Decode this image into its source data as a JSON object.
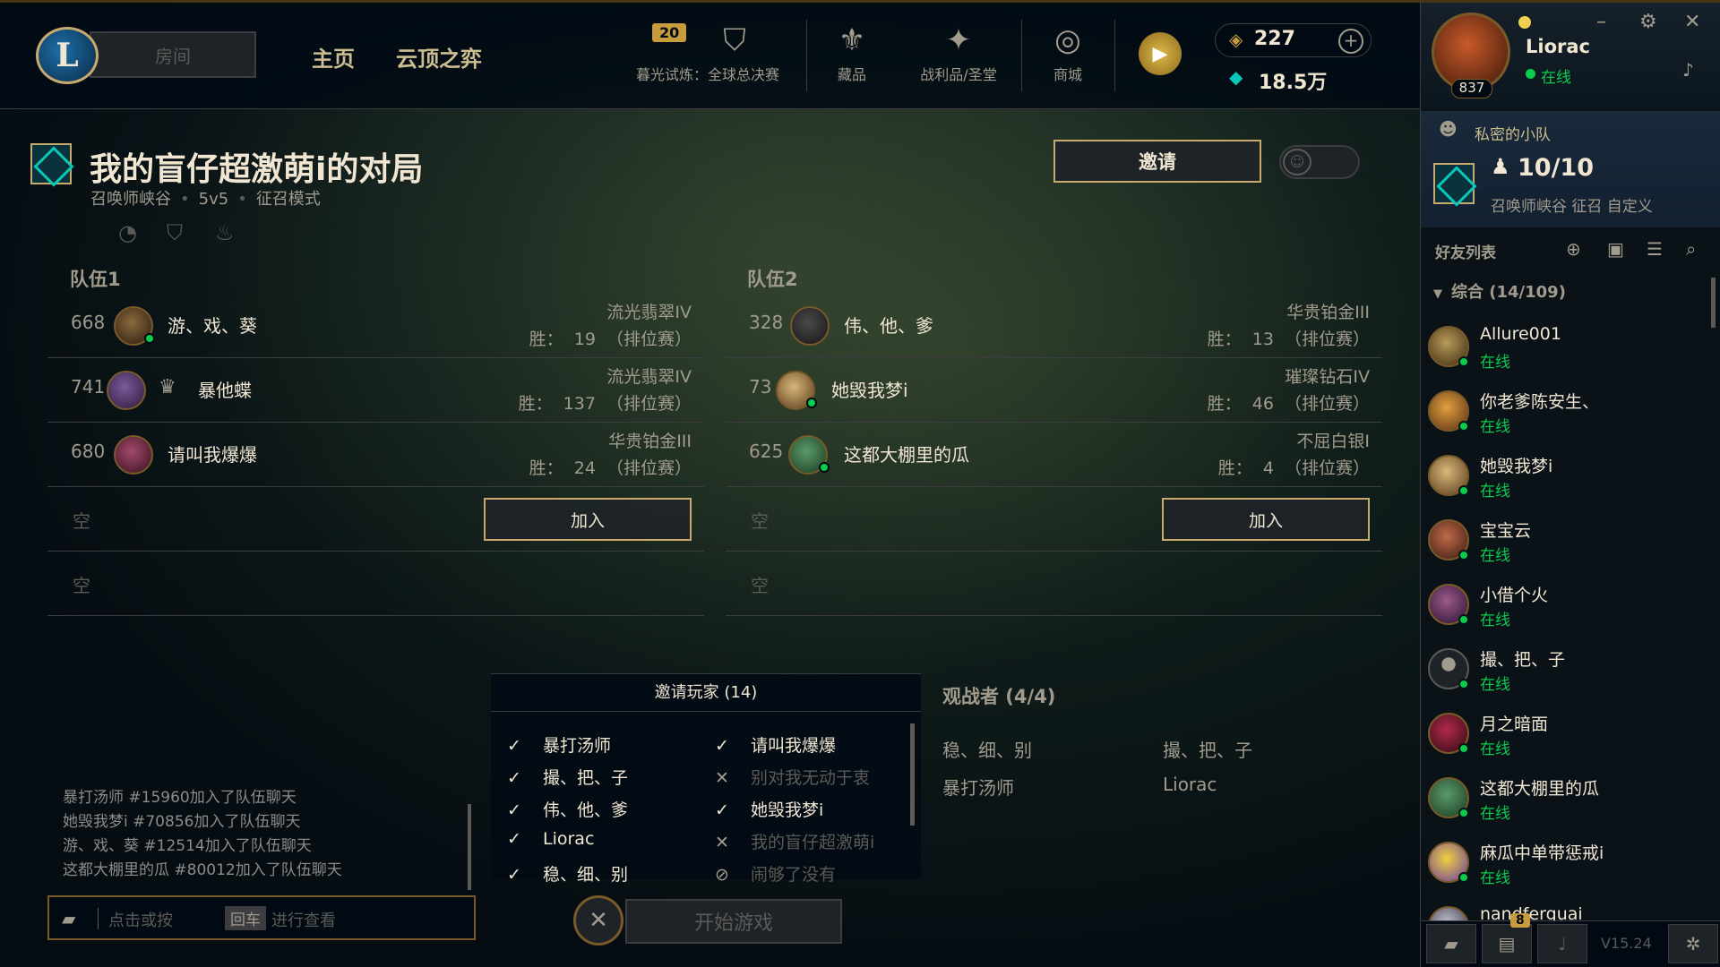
{
  "nav": {
    "room_label": "房间",
    "home": "主页",
    "tft": "云顶之弈",
    "event_badge": "20",
    "event_label": "暮光试炼：全球总决赛",
    "collection": "藏品",
    "loot": "战利品/圣堂",
    "store": "商城",
    "rp": "227",
    "blue_essence": "18.5万"
  },
  "lobby": {
    "title": "我的盲仔超激萌i的对局",
    "map": "召唤师峡谷",
    "size": "5v5",
    "mode": "征召模式",
    "invite_button": "邀请"
  },
  "teams": [
    {
      "label": "队伍1",
      "players": [
        {
          "level": "668",
          "name": "游、戏、葵",
          "rank": "流光翡翠IV",
          "wins": "胜：  19  （排位赛）",
          "online": true
        },
        {
          "level": "741",
          "name": "暴他蝶",
          "rank": "流光翡翠IV",
          "wins": "胜：  137  （排位赛）",
          "online": false
        },
        {
          "level": "680",
          "name": "请叫我爆爆",
          "rank": "华贵铂金III",
          "wins": "胜：  24  （排位赛）",
          "online": false
        }
      ],
      "empty_label": "空",
      "join_label": "加入"
    },
    {
      "label": "队伍2",
      "players": [
        {
          "level": "328",
          "name": "伟、他、爹",
          "rank": "华贵铂金III",
          "wins": "胜：  13  （排位赛）",
          "online": false
        },
        {
          "level": "73",
          "name": "她毁我梦i",
          "rank": "璀璨钻石IV",
          "wins": "胜：  46  （排位赛）",
          "online": true
        },
        {
          "level": "625",
          "name": "这都大棚里的瓜",
          "rank": "不屈白银I",
          "wins": "胜：  4  （排位赛）",
          "online": true
        }
      ],
      "empty_label": "空",
      "join_label": "加入"
    }
  ],
  "chat": {
    "lines": [
      "暴打汤师 #15960加入了队伍聊天",
      "她毁我梦i #70856加入了队伍聊天",
      "游、戏、葵 #12514加入了队伍聊天",
      "这都大棚里的瓜 #80012加入了队伍聊天"
    ],
    "placeholder_a": "点击或按",
    "key": "回车",
    "placeholder_b": "进行查看"
  },
  "invited": {
    "title": "邀请玩家 (14)",
    "items": [
      {
        "name": "暴打汤师",
        "mark": "✓",
        "state": "accepted"
      },
      {
        "name": "请叫我爆爆",
        "mark": "✓",
        "state": "accepted"
      },
      {
        "name": "撮、把、子",
        "mark": "✓",
        "state": "accepted"
      },
      {
        "name": "别对我无动于衷",
        "mark": "✕",
        "state": "declined"
      },
      {
        "name": "伟、他、爹",
        "mark": "✓",
        "state": "accepted"
      },
      {
        "name": "她毁我梦i",
        "mark": "✓",
        "state": "accepted"
      },
      {
        "name": "Liorac",
        "mark": "✓",
        "state": "accepted"
      },
      {
        "name": "我的盲仔超激萌i",
        "mark": "✕",
        "state": "declined"
      },
      {
        "name": "稳、细、别",
        "mark": "✓",
        "state": "accepted"
      },
      {
        "name": "闹够了没有",
        "mark": "⊘",
        "state": "blocked"
      }
    ],
    "start_label": "开始游戏"
  },
  "spectators": {
    "title": "观战者 (4/4)",
    "names": [
      "稳、细、别",
      "撮、把、子",
      "暴打汤师",
      "Liorac"
    ]
  },
  "profile": {
    "name": "Liorac",
    "status": "在线",
    "level": "837"
  },
  "party": {
    "header": "私密的小队",
    "count": "10/10",
    "mode": "召唤师峡谷 征召 自定义"
  },
  "friends": {
    "header": "好友列表",
    "group": "综合 (14/109)",
    "list": [
      {
        "name": "Allure001",
        "status": "在线"
      },
      {
        "name": "你老爹陈安生、",
        "status": "在线"
      },
      {
        "name": "她毁我梦i",
        "status": "在线"
      },
      {
        "name": "宝宝云",
        "status": "在线"
      },
      {
        "name": "小借个火",
        "status": "在线"
      },
      {
        "name": "撮、把、子",
        "status": "在线"
      },
      {
        "name": "月之暗面",
        "status": "在线"
      },
      {
        "name": "这都大棚里的瓜",
        "status": "在线"
      },
      {
        "name": "麻瓜中单带惩戒i",
        "status": "在线"
      },
      {
        "name": "nandferguai",
        "status": ""
      }
    ]
  },
  "bottom": {
    "badge": "8",
    "version": "V15.24"
  }
}
